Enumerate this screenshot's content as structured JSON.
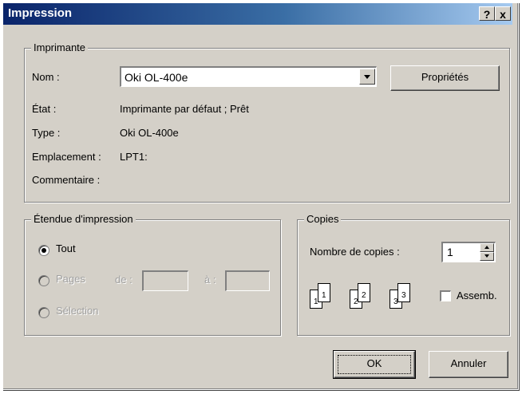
{
  "window": {
    "title": "Impression",
    "help_label": "?",
    "close_label": "x"
  },
  "printer": {
    "group_title": "Imprimante",
    "name_label": "Nom :",
    "name_value": "Oki OL-400e",
    "properties_button": "Propriétés",
    "status_label": "État :",
    "status_value": "Imprimante par défaut ; Prêt",
    "type_label": "Type :",
    "type_value": "Oki OL-400e",
    "location_label": "Emplacement :",
    "location_value": "LPT1:",
    "comment_label": "Commentaire :"
  },
  "range": {
    "group_title": "Étendue d'impression",
    "all_label": "Tout",
    "pages_label": "Pages",
    "from_label": "de :",
    "to_label": "à :",
    "selection_label": "Sélection",
    "selected": "Tout"
  },
  "copies": {
    "group_title": "Copies",
    "count_label": "Nombre de copies :",
    "count_value": "1",
    "collate_label": "Assemb.",
    "collate_checked": false,
    "page_numbers": [
      "1",
      "1",
      "2",
      "2",
      "3",
      "3"
    ]
  },
  "buttons": {
    "ok": "OK",
    "cancel": "Annuler"
  },
  "icons": [
    "help-icon",
    "close-icon",
    "dropdown-arrow-icon",
    "spin-up-icon",
    "spin-down-icon",
    "collate-pages-icon"
  ]
}
